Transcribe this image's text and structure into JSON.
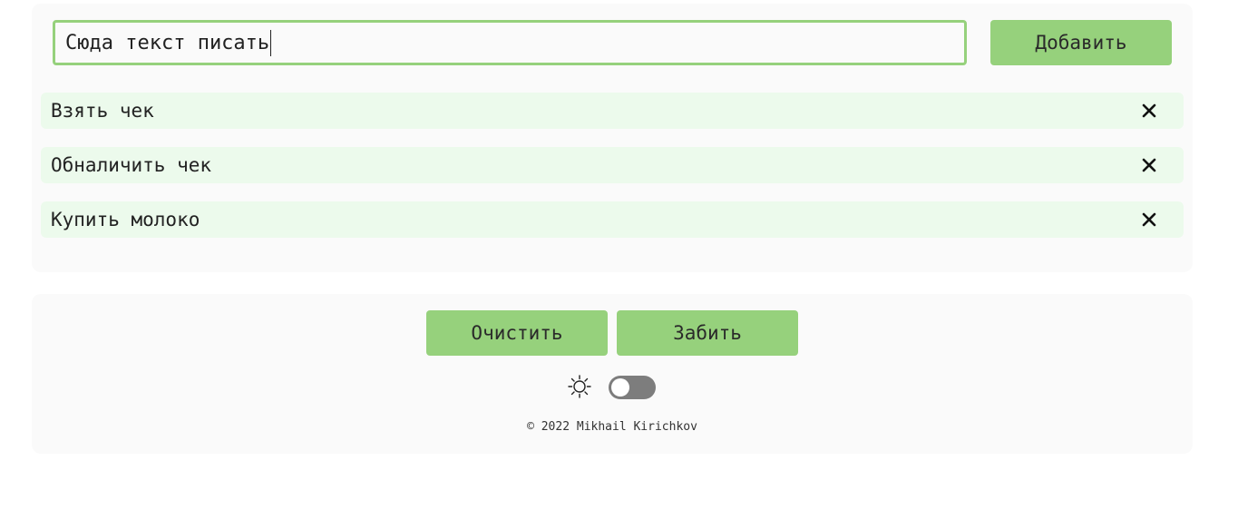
{
  "input": {
    "value": "Сюда текст писать"
  },
  "buttons": {
    "add_label": "Добавить",
    "clear_label": "Очистить",
    "forget_label": "Забить"
  },
  "todos": [
    {
      "label": "Взять чек"
    },
    {
      "label": "Обналичить чек"
    },
    {
      "label": "Купить молоко"
    }
  ],
  "icons": {
    "delete": "close-icon",
    "theme": "sun-icon"
  },
  "theme_toggle": {
    "dark_mode": false
  },
  "footer": {
    "copyright": "© 2022 Mikhail Kirichkov"
  },
  "colors": {
    "accent": "#96d17c",
    "todo_background": "#ecfaec",
    "panel_background": "#fafafa",
    "toggle_off": "#7d7d7d"
  }
}
